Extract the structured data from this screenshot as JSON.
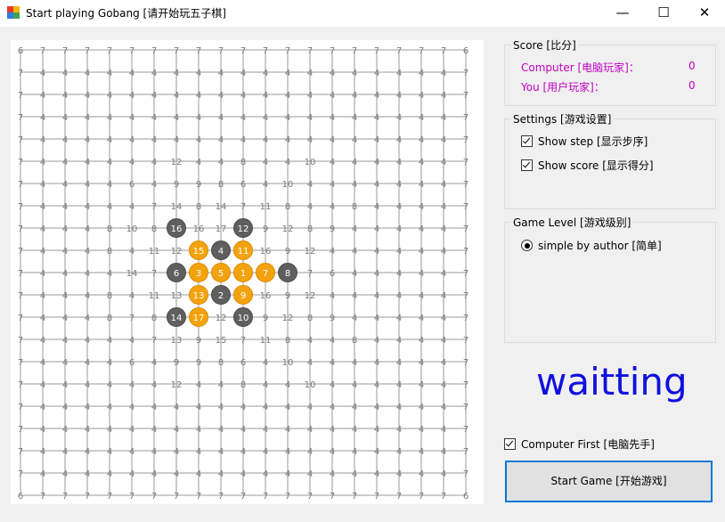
{
  "window": {
    "title": "Start playing Gobang [请开始玩五子棋]",
    "minimize_label": "—",
    "maximize_label": "☐",
    "close_label": "✕"
  },
  "score": {
    "group_title": "Score [比分]",
    "computer_label": "Computer [电脑玩家]：",
    "computer_value": "0",
    "user_label": "You [用户玩家]：",
    "user_value": "0"
  },
  "settings": {
    "group_title": "Settings [游戏设置]",
    "show_step_label": "Show step [显示步序]",
    "show_step_checked": true,
    "show_score_label": "Show score [显示得分]",
    "show_score_checked": true
  },
  "level": {
    "group_title": "Game Level [游戏级别]",
    "option_label": "simple by author [简单]",
    "option_selected": true
  },
  "status_text": "waitting",
  "computer_first": {
    "label": "Computer First [电脑先手]",
    "checked": true
  },
  "start_button_label": "Start Game [开始游戏]",
  "colors": {
    "black_stone": "#5f5f5f",
    "white_stone": "#f4a30e",
    "grid": "#9a9a9a",
    "cell_score": "#7a7a7a",
    "status": "#1010e0",
    "score_text": "#c000c0"
  },
  "board": {
    "size": 21,
    "score_grid": [
      "6 7 7 7 7 7 7 7 7 7 7 7 7 7 7 7 7 7 7 7 6",
      "7 4 4 4 4 4 4 4 4 4 4 4 4 4 4 4 4 4 4 4 7",
      "7 4 4 4 4 4 4 4 4 4 4 4 4 4 4 4 4 4 4 4 7",
      "7 4 4 4 4 4 4 4 4 4 4 4 4 4 4 4 4 4 4 4 7",
      "7 4 4 4 4 4 4 4 4 4 4 4 4 4 4 4 4 4 4 4 7",
      "7 4 4 4 4 4 4 12 4 4 8 4 4 10 4 4 4 4 4 4 7",
      "7 4 4 4 4 6 4 9 9 8 6 4 10 4 4 4 4 4 4 4 7",
      "7 4 4 4 4 4 7 14 8 14 7 11 8 4 4 8 4 4 4 4 7",
      "7 4 4 4 8 10 8 * 16 17 * 9 12 8 9 4 4 4 4 4 7",
      "7 4 4 4 8 4 11 12 * * * 16 9 12 4 4 4 4 4 4 7",
      "7 4 4 4 4 14 7 * * * * * * 7 6 4 4 4 4 4 7",
      "7 4 4 4 8 4 11 13 * * * 16 9 12 4 4 4 4 4 4 7",
      "7 4 4 4 8 7 8 * * 12 * 9 12 8 9 4 4 4 4 4 7",
      "7 4 4 4 4 4 7 13 9 15 7 11 8 4 4 8 4 4 4 4 7",
      "7 4 4 4 4 6 4 9 9 8 6 4 10 4 4 4 4 4 4 4 7",
      "7 4 4 4 4 4 4 12 4 4 8 4 4 10 4 4 4 4 4 4 7",
      "7 4 4 4 4 4 4 4 4 4 4 4 4 4 4 4 4 4 4 4 7",
      "7 4 4 4 4 4 4 4 4 4 4 4 4 4 4 4 4 4 4 4 7",
      "7 4 4 4 4 4 4 4 4 4 4 4 4 4 4 4 4 4 4 4 7",
      "7 4 4 4 4 4 4 4 4 4 4 4 4 4 4 4 4 4 4 4 7",
      "6 7 7 7 7 7 7 7 7 7 7 7 7 7 7 7 7 7 7 7 6"
    ],
    "stones": [
      {
        "col": 7,
        "row": 8,
        "color": "black",
        "step": "16"
      },
      {
        "col": 10,
        "row": 8,
        "color": "black",
        "step": "12"
      },
      {
        "col": 8,
        "row": 9,
        "color": "white",
        "step": "15"
      },
      {
        "col": 9,
        "row": 9,
        "color": "black",
        "step": "4"
      },
      {
        "col": 10,
        "row": 9,
        "color": "white",
        "step": "11"
      },
      {
        "col": 7,
        "row": 10,
        "color": "black",
        "step": "6"
      },
      {
        "col": 8,
        "row": 10,
        "color": "white",
        "step": "3"
      },
      {
        "col": 9,
        "row": 10,
        "color": "white",
        "step": "5"
      },
      {
        "col": 10,
        "row": 10,
        "color": "white",
        "step": "1"
      },
      {
        "col": 11,
        "row": 10,
        "color": "white",
        "step": "7"
      },
      {
        "col": 12,
        "row": 10,
        "color": "black",
        "step": "8"
      },
      {
        "col": 8,
        "row": 11,
        "color": "white",
        "step": "13"
      },
      {
        "col": 9,
        "row": 11,
        "color": "black",
        "step": "2"
      },
      {
        "col": 10,
        "row": 11,
        "color": "white",
        "step": "9"
      },
      {
        "col": 7,
        "row": 12,
        "color": "black",
        "step": "14"
      },
      {
        "col": 8,
        "row": 12,
        "color": "white",
        "step": "17"
      },
      {
        "col": 10,
        "row": 12,
        "color": "black",
        "step": "10"
      }
    ]
  }
}
